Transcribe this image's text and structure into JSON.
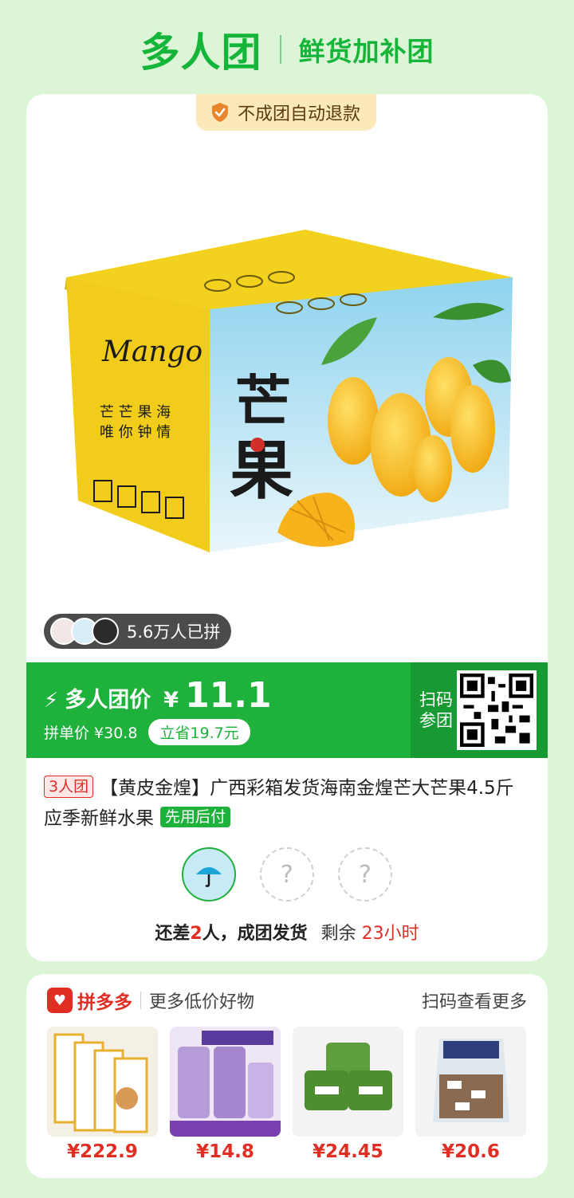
{
  "header": {
    "logo": "多人团",
    "subtitle": "鲜货加补团"
  },
  "card": {
    "refund_badge": "不成团自动退款",
    "joined_count": "5.6万人已拼",
    "price": {
      "label": "多人团价",
      "currency": "¥",
      "value": "11.1",
      "single_label": "拼单价 ¥30.8",
      "save": "立省19.7元"
    },
    "scan": "扫码参团",
    "title": {
      "tag": "3人团",
      "text": "【黄皮金煌】广西彩箱发货海南金煌芒大芒果4.5斤应季新鲜水果",
      "pay_tag": "先用后付"
    },
    "status": {
      "prefix": "还差",
      "count": "2",
      "suffix": "人，成团发货",
      "remain_label": "剩余",
      "remain_time": "23小时"
    },
    "box_text": {
      "brand": "Mango",
      "slogan": "芒芒果海 唯你钟情",
      "big": "芒果"
    }
  },
  "pdd": {
    "brand": "拼多多",
    "sub": "更多低价好物",
    "more": "扫码查看更多",
    "products": [
      {
        "price": "¥222.9"
      },
      {
        "price": "¥14.8"
      },
      {
        "price": "¥24.45"
      },
      {
        "price": "¥20.6"
      }
    ]
  },
  "colors": {
    "bg": "#dbf5d6",
    "green": "#1eb13c",
    "red": "#e02e24"
  }
}
